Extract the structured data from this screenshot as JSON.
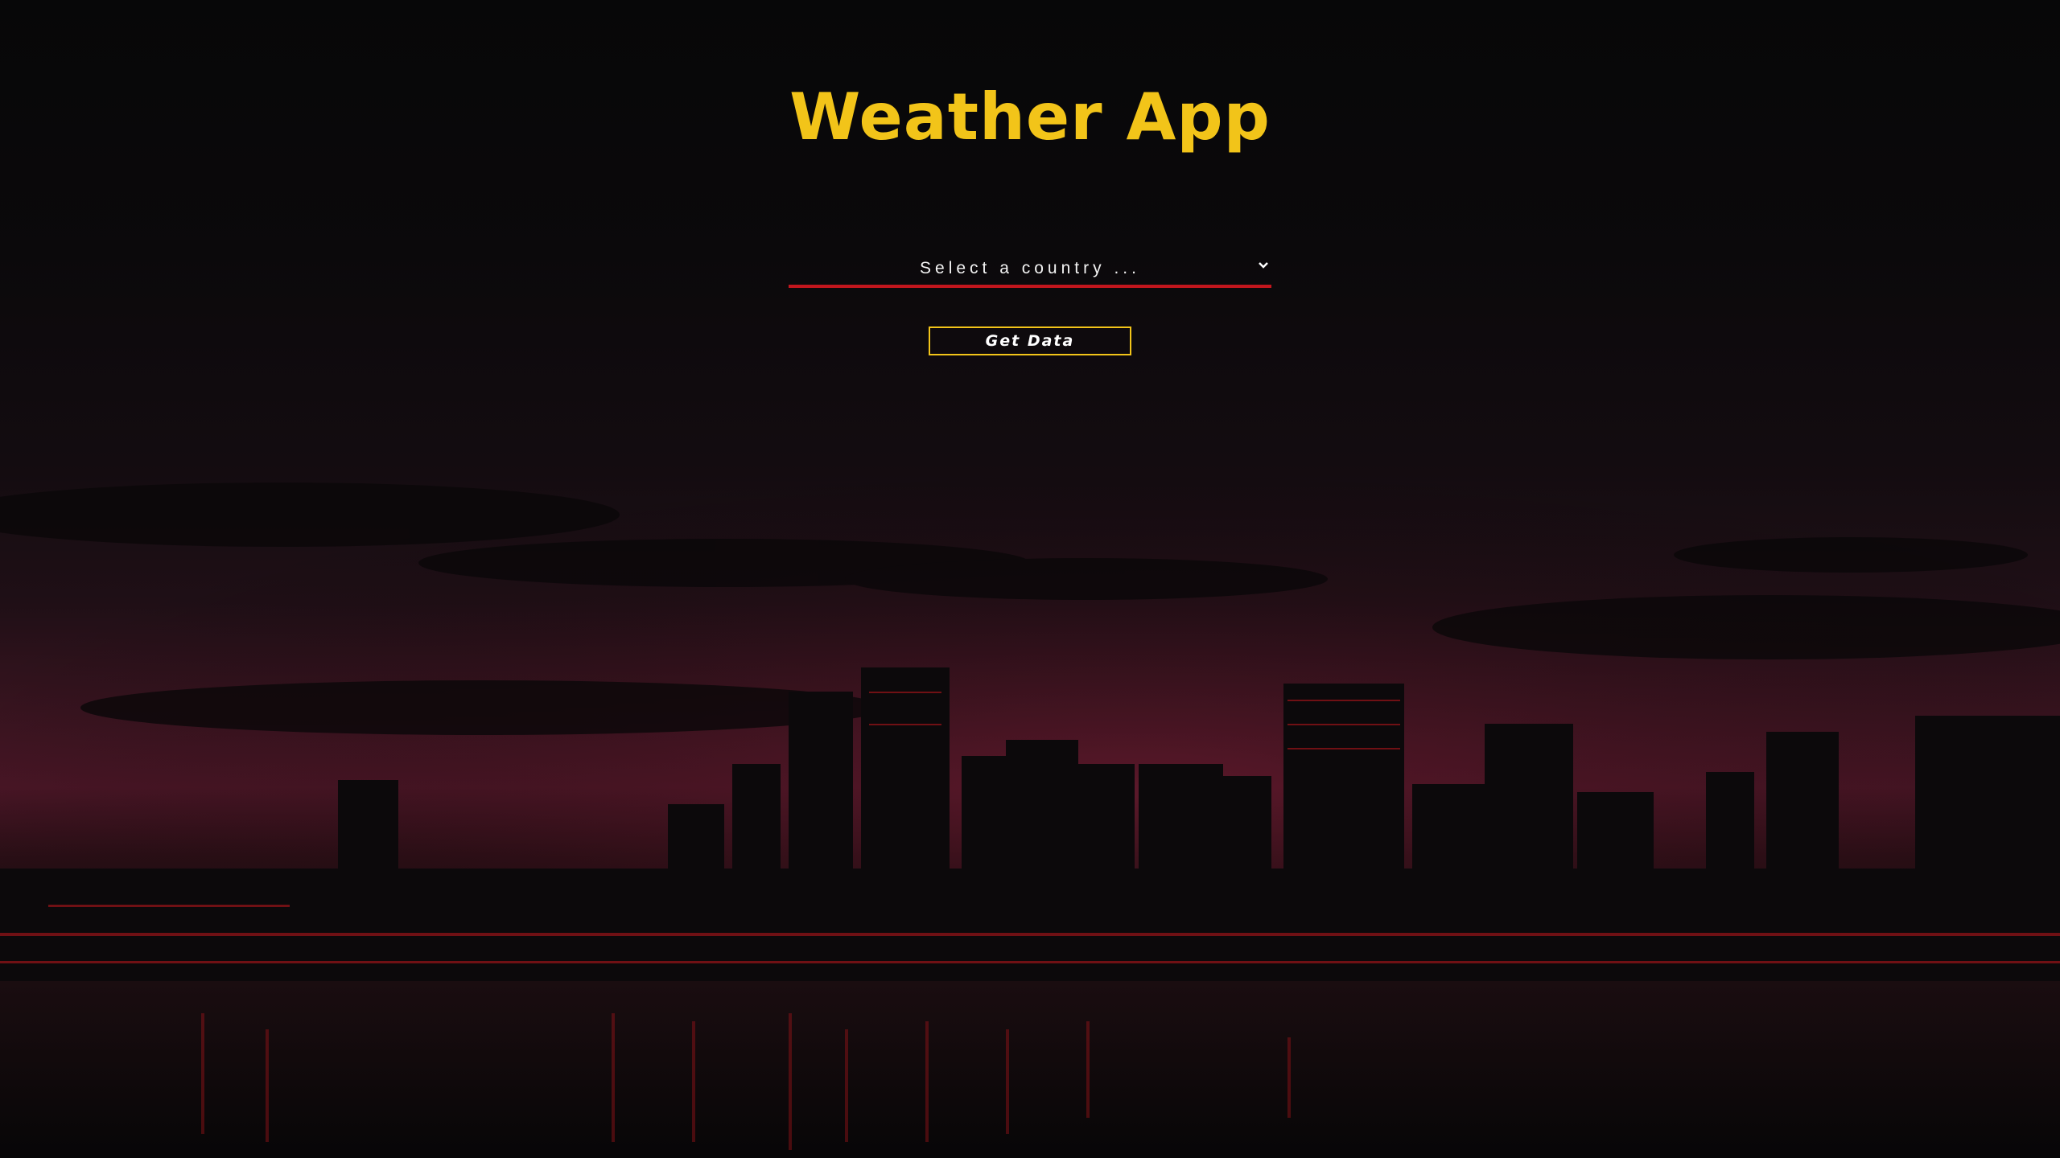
{
  "app": {
    "title": "Weather App"
  },
  "country_select": {
    "selected_label": "Select a country ..."
  },
  "actions": {
    "get_data_label": "Get Data"
  },
  "theme": {
    "title_color": "#f2c419",
    "underline_color": "#c2161d",
    "button_border_color": "#f2c419",
    "background": "night city skyline with red glow",
    "icons": [
      "chevron-down-icon"
    ]
  }
}
